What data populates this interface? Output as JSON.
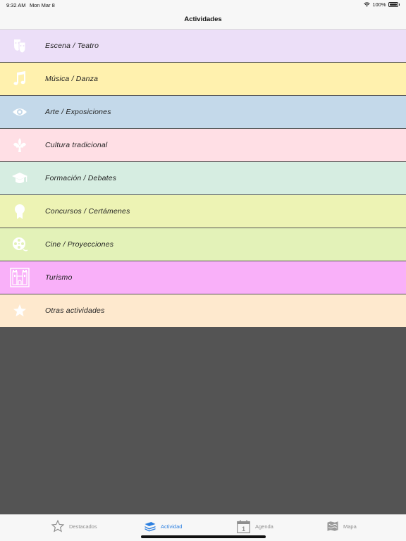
{
  "status": {
    "time": "9:32 AM",
    "date": "Mon Mar 8",
    "battery": "100%"
  },
  "nav": {
    "title": "Actividades"
  },
  "categories": [
    {
      "label": "Escena / Teatro",
      "icon": "theater-masks-icon",
      "color": "#ecdff8"
    },
    {
      "label": "Música / Danza",
      "icon": "music-note-icon",
      "color": "#fff1ae"
    },
    {
      "label": "Arte / Exposiciones",
      "icon": "eye-icon",
      "color": "#c4d9ea"
    },
    {
      "label": "Cultura tradicional",
      "icon": "fleur-de-lis-icon",
      "color": "#ffdfe5"
    },
    {
      "label": "Formación / Debates",
      "icon": "graduation-cap-icon",
      "color": "#d6ede1"
    },
    {
      "label": "Concursos / Certámenes",
      "icon": "award-ribbon-icon",
      "color": "#edf3b4"
    },
    {
      "label": "Cine / Proyecciones",
      "icon": "film-reel-icon",
      "color": "#e3f2b8"
    },
    {
      "label": "Turismo",
      "icon": "castle-icon",
      "color": "#f9b0f9"
    },
    {
      "label": "Otras actividades",
      "icon": "star-icon",
      "color": "#fee9ce"
    }
  ],
  "tabbar": {
    "tabs": [
      {
        "label": "Destacados",
        "icon": "star-outline-icon",
        "active": false
      },
      {
        "label": "Actividad",
        "icon": "layers-icon",
        "active": true
      },
      {
        "label": "Agenda",
        "icon": "calendar-icon",
        "active": false,
        "icon_text": "1"
      },
      {
        "label": "Mapa",
        "icon": "map-icon",
        "active": false
      }
    ],
    "active_color": "#2b7fe0"
  }
}
